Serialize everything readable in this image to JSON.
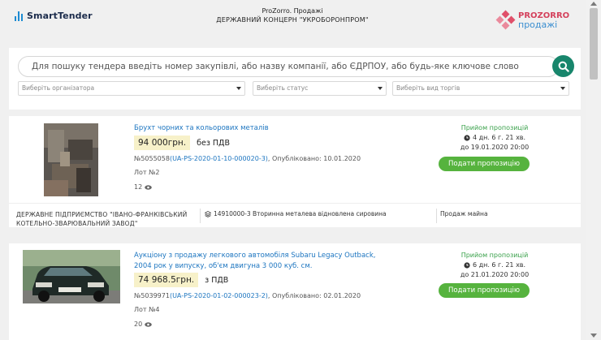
{
  "header": {
    "brand": "SmartTender",
    "subtitle": "ProZorro. Продажі",
    "organizer": "ДЕРЖАВНИЙ КОНЦЕРН \"УКРОБОРОНПРОМ\"",
    "partner_top": "PROZORRO",
    "partner_bottom": "продажі"
  },
  "search": {
    "placeholder": "Для пошуку тендера введіть номер закупівлі, або назву компанії, або ЄДРПОУ, або будь-яке ключове слово",
    "button_icon": "search-icon",
    "filters": [
      {
        "placeholder": "Виберіть організатора"
      },
      {
        "placeholder": "Виберіть статус"
      },
      {
        "placeholder": "Виберіть вид торгів"
      }
    ]
  },
  "lots": [
    {
      "title": "Брухт чорних та кольорових металів",
      "price": "94 000грн.",
      "vat": "без ПДВ",
      "number": "№5055058",
      "id_link": "(UA-PS-2020-01-10-000020-3)",
      "published": ", Опубліковано: 10.01.2020",
      "lot_label": "Лот №2",
      "views": "12",
      "status": "Прийом пропозицій",
      "time_left": "4 дн. 6 г. 21 хв.",
      "deadline": "до 19.01.2020 20:00",
      "bid_label": "Подати пропозицію",
      "organizer_name": "ДЕРЖАВНЕ ПІДПРИЄМСТВО \"ІВАНО-ФРАНКІВСЬКИЙ КОТЕЛЬНО-ЗВАРЮВАЛЬНИЙ ЗАВОД\"",
      "cpv": "14910000-3 Вторинна металева відновлена сировина",
      "kind": "Продаж майна"
    },
    {
      "title": "Аукціону з продажу легкового автомобіля Subaru Legacy Outback, 2004 рок у випуску, об'єм двигуна 3 000 куб. см.",
      "price": "74 968.5грн.",
      "vat": "з ПДВ",
      "number": "№5039971",
      "id_link": "(UA-PS-2020-01-02-000023-2)",
      "published": ", Опубліковано: 02.01.2020",
      "lot_label": "Лот №4",
      "views": "20",
      "status": "Прийом пропозицій",
      "time_left": "6 дн. 6 г. 21 хв.",
      "deadline": "до 21.01.2020 20:00",
      "bid_label": "Подати пропозицію"
    }
  ],
  "colors": {
    "link": "#1c75c0",
    "status_green": "#3aa14b",
    "button_green": "#56b33e",
    "price_bg": "#f7f1c9",
    "search_button": "#18866c"
  }
}
